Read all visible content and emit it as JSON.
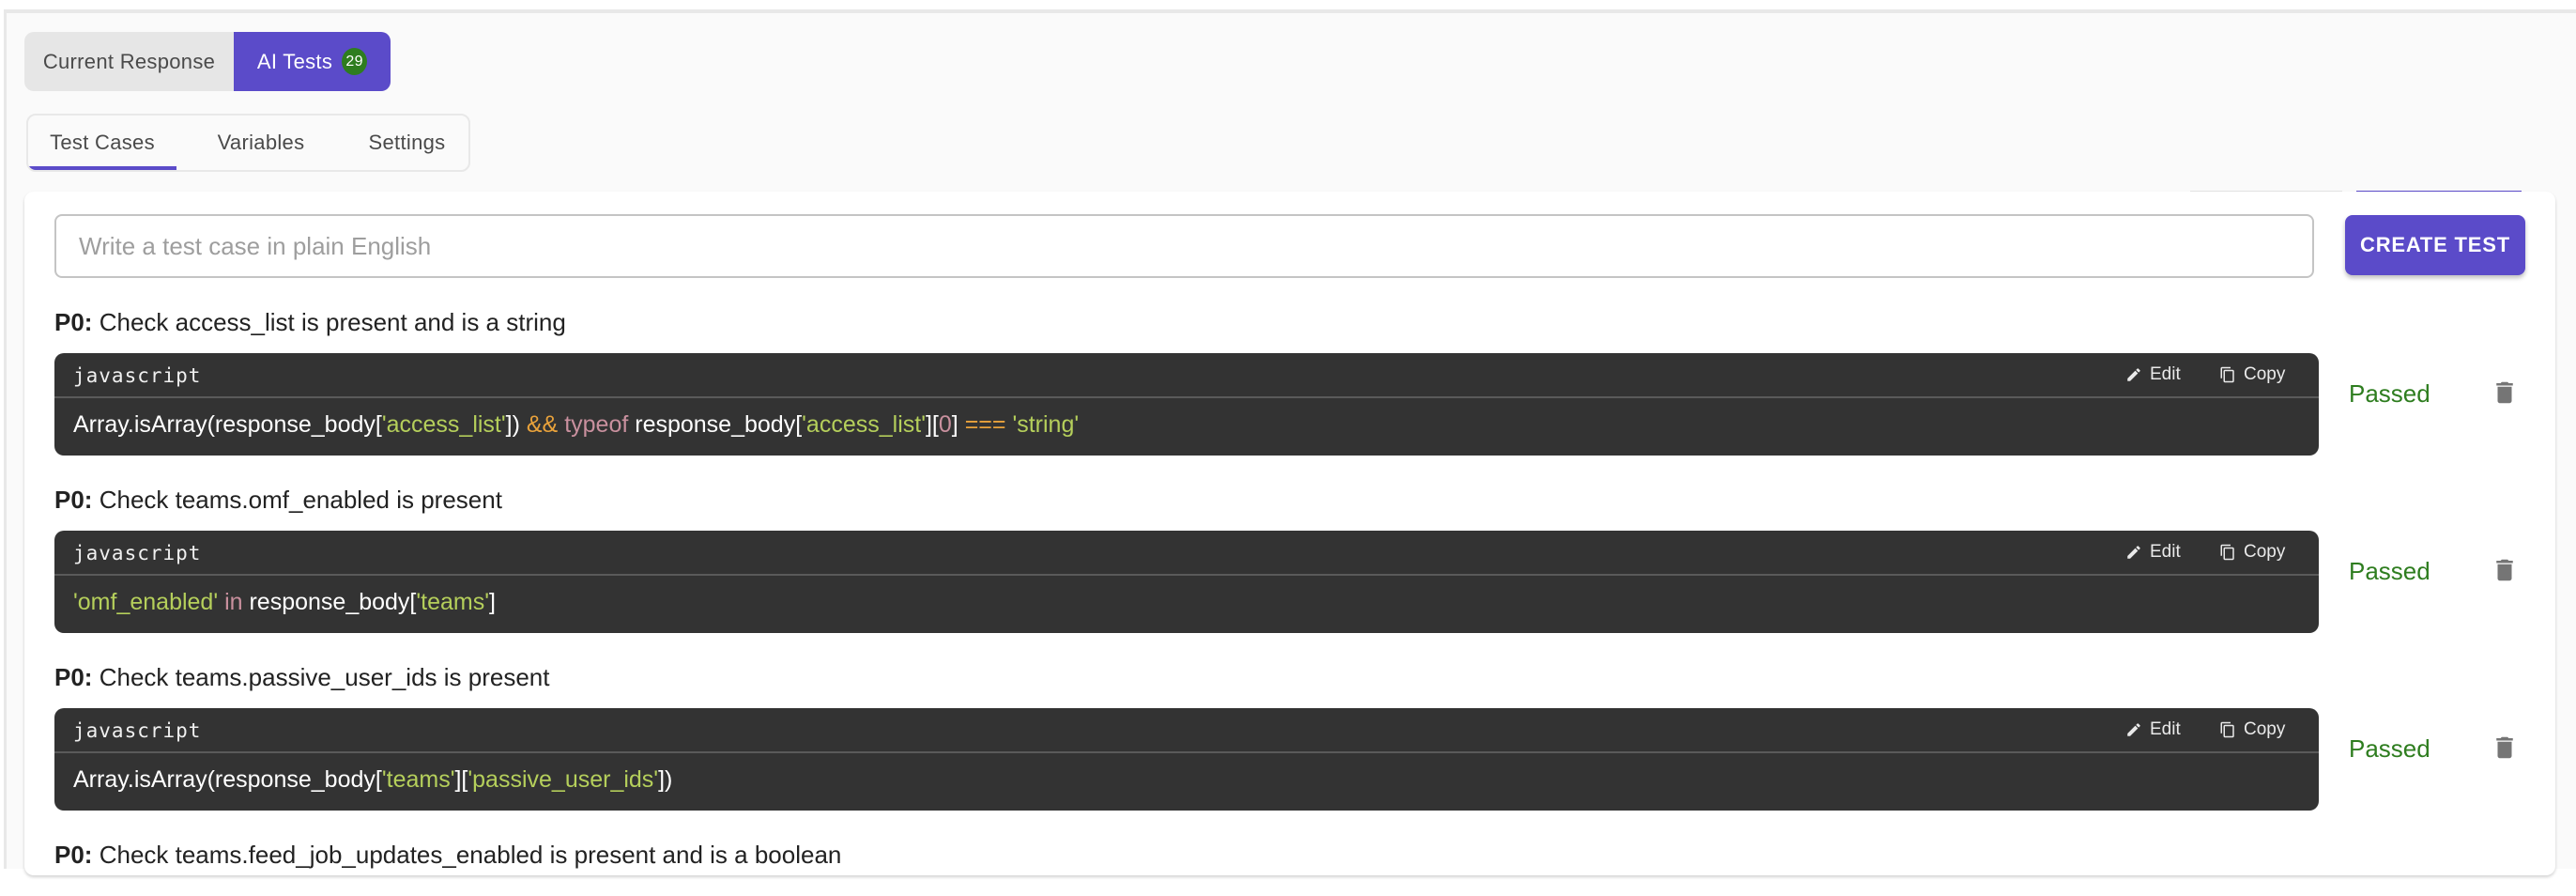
{
  "view_toggle": {
    "options": [
      {
        "label": "Current Response",
        "active": false
      },
      {
        "label": "AI Tests",
        "active": true,
        "badge": "29"
      }
    ]
  },
  "subtabs": [
    {
      "label": "Test Cases",
      "active": true
    },
    {
      "label": "Variables",
      "active": false
    },
    {
      "label": "Settings",
      "active": false
    }
  ],
  "new_test": {
    "placeholder": "Write a test case in plain English",
    "value": "",
    "create_label": "CREATE TEST"
  },
  "colors": {
    "accent": "#5b4bc9",
    "badge": "#2e7d1f",
    "passed": "#2e7d1f",
    "code_bg": "#333333",
    "code_string": "#b5cf5b",
    "code_keyword": "#c9909e",
    "code_operator": "#e9a23b"
  },
  "tests": [
    {
      "priority": "P0:",
      "title": "Check access_list is present and is a string",
      "language": "javascript",
      "edit_label": "Edit",
      "copy_label": "Copy",
      "status": "Passed",
      "code_tokens": [
        {
          "t": "plain",
          "v": "Array.isArray(response_body["
        },
        {
          "t": "str",
          "v": "'access_list'"
        },
        {
          "t": "plain",
          "v": "]) "
        },
        {
          "t": "op",
          "v": "&&"
        },
        {
          "t": "plain",
          "v": " "
        },
        {
          "t": "kw",
          "v": "typeof"
        },
        {
          "t": "plain",
          "v": " response_body["
        },
        {
          "t": "str",
          "v": "'access_list'"
        },
        {
          "t": "plain",
          "v": "]["
        },
        {
          "t": "num",
          "v": "0"
        },
        {
          "t": "plain",
          "v": "] "
        },
        {
          "t": "op",
          "v": "==="
        },
        {
          "t": "plain",
          "v": " "
        },
        {
          "t": "str",
          "v": "'string'"
        }
      ]
    },
    {
      "priority": "P0:",
      "title": "Check teams.omf_enabled is present",
      "language": "javascript",
      "edit_label": "Edit",
      "copy_label": "Copy",
      "status": "Passed",
      "code_tokens": [
        {
          "t": "str",
          "v": "'omf_enabled'"
        },
        {
          "t": "plain",
          "v": " "
        },
        {
          "t": "kw",
          "v": "in"
        },
        {
          "t": "plain",
          "v": " response_body["
        },
        {
          "t": "str",
          "v": "'teams'"
        },
        {
          "t": "plain",
          "v": "]"
        }
      ]
    },
    {
      "priority": "P0:",
      "title": "Check teams.passive_user_ids is present",
      "language": "javascript",
      "edit_label": "Edit",
      "copy_label": "Copy",
      "status": "Passed",
      "code_tokens": [
        {
          "t": "plain",
          "v": "Array.isArray(response_body["
        },
        {
          "t": "str",
          "v": "'teams'"
        },
        {
          "t": "plain",
          "v": "]["
        },
        {
          "t": "str",
          "v": "'passive_user_ids'"
        },
        {
          "t": "plain",
          "v": "])"
        }
      ]
    },
    {
      "priority": "P0:",
      "title": "Check teams.feed_job_updates_enabled is present and is a boolean"
    }
  ]
}
